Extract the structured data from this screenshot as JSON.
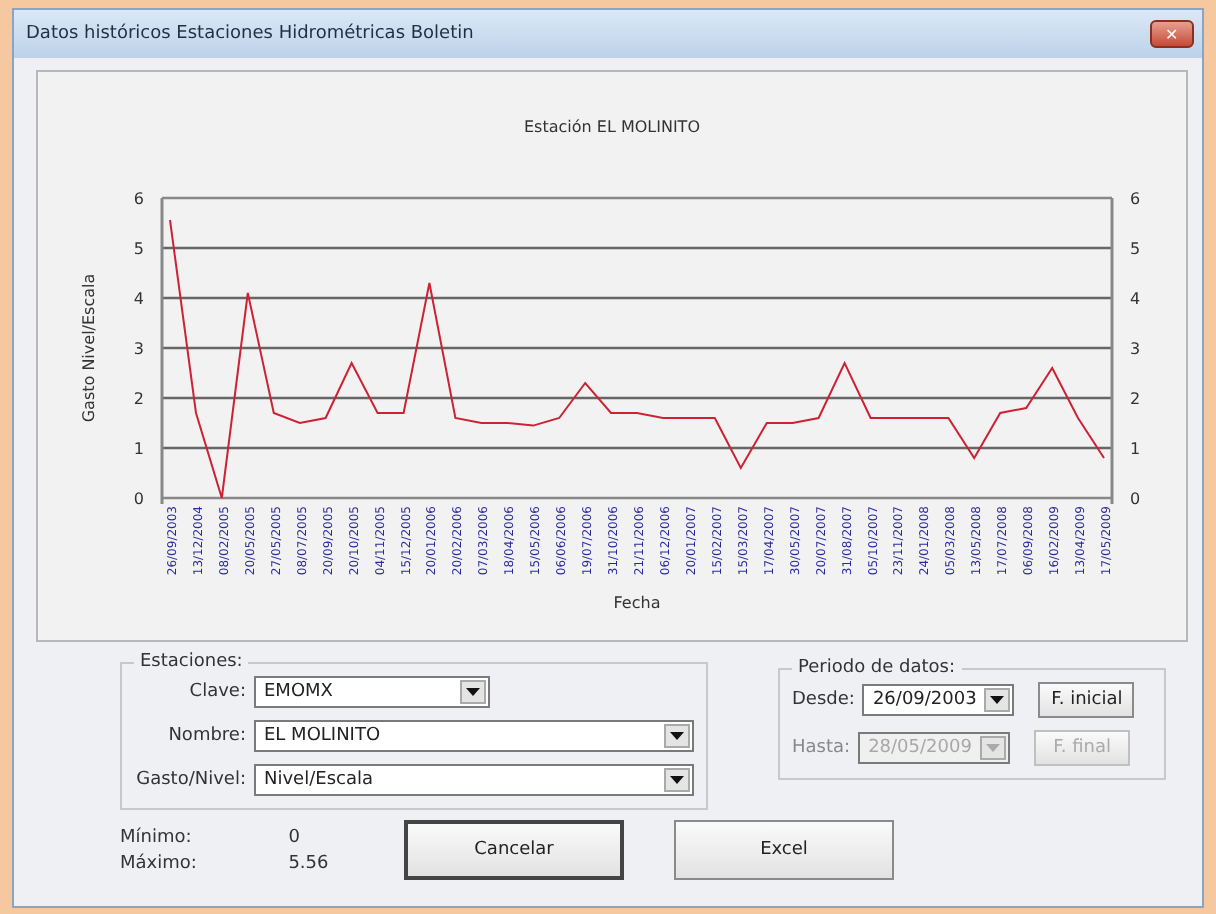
{
  "window": {
    "title": "Datos históricos Estaciones Hidrométricas Boletin",
    "close": "✕"
  },
  "chart": {
    "chart_data": {
      "type": "line",
      "title": "Estación EL MOLINITO",
      "xlabel": "Fecha",
      "ylabel": "Gasto Nivel/Escala",
      "ylim": [
        0,
        6
      ],
      "yticks": [
        0,
        1,
        2,
        3,
        4,
        5,
        6
      ],
      "y2lim": [
        0,
        6
      ],
      "y2ticks": [
        0,
        1,
        2,
        3,
        4,
        5,
        6
      ],
      "grid": true,
      "categories": [
        "26/09/2003",
        "13/12/2004",
        "08/02/2005",
        "20/05/2005",
        "27/05/2005",
        "08/07/2005",
        "20/09/2005",
        "20/10/2005",
        "04/11/2005",
        "15/12/2005",
        "20/01/2006",
        "20/02/2006",
        "07/03/2006",
        "18/04/2006",
        "15/05/2006",
        "06/06/2006",
        "19/07/2006",
        "31/10/2006",
        "21/11/2006",
        "06/12/2006",
        "20/01/2007",
        "15/02/2007",
        "15/03/2007",
        "17/04/2007",
        "30/05/2007",
        "20/07/2007",
        "31/08/2007",
        "05/10/2007",
        "23/11/2007",
        "24/01/2008",
        "05/03/2008",
        "13/05/2008",
        "17/07/2008",
        "06/09/2008",
        "16/02/2009",
        "13/04/2009",
        "17/05/2009"
      ],
      "series": [
        {
          "color": "#cc2233",
          "values": [
            5.56,
            1.7,
            0,
            4.1,
            1.7,
            1.5,
            1.6,
            2.7,
            1.7,
            1.7,
            4.3,
            1.6,
            1.5,
            1.5,
            1.45,
            1.6,
            2.3,
            1.7,
            1.7,
            1.6,
            1.6,
            1.6,
            0.6,
            1.5,
            1.5,
            1.6,
            2.7,
            1.6,
            1.6,
            1.6,
            1.6,
            0.8,
            1.7,
            1.8,
            2.6,
            1.6,
            0.8
          ]
        }
      ]
    }
  },
  "estaciones": {
    "legend": "Estaciones:",
    "fields": [
      {
        "label": "Clave:",
        "value": "EMOMX",
        "wide": false
      },
      {
        "label": "Nombre:",
        "value": "EL MOLINITO",
        "wide": true
      },
      {
        "label": "Gasto/Nivel:",
        "value": "Nivel/Escala",
        "wide": true
      }
    ]
  },
  "periodo": {
    "legend": "Periodo de datos:",
    "rows": [
      {
        "label": "Desde:",
        "value": "26/09/2003",
        "button": "F. inicial",
        "disabled": false
      },
      {
        "label": "Hasta:",
        "value": "28/05/2009",
        "button": "F. final",
        "disabled": true
      }
    ]
  },
  "stats": [
    {
      "label": "Mínimo:",
      "value": "0"
    },
    {
      "label": "Máximo:",
      "value": "5.56"
    }
  ],
  "buttons": [
    {
      "label": "Cancelar",
      "default": true
    },
    {
      "label": "Excel",
      "default": false
    }
  ]
}
